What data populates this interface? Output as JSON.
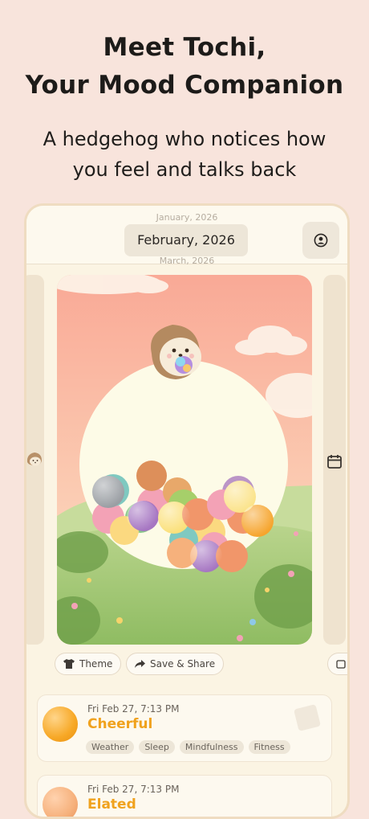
{
  "hero": {
    "title_line1": "Meet Tochi,",
    "title_line2": "Your Mood Companion",
    "subtitle_line1": "A hedgehog who notices how",
    "subtitle_line2": "you feel and talks back"
  },
  "header": {
    "prev_month": "January, 2026",
    "current_month": "February, 2026",
    "next_month": "March, 2026",
    "profile_icon": "profile-icon"
  },
  "side": {
    "left_icon": "hedgehog-icon",
    "right_icon": "calendar-icon"
  },
  "colors": {
    "background": "#f8e4dc",
    "accent": "#f0a21e",
    "card": "#fdf9ef"
  },
  "actions": {
    "theme_label": "Theme",
    "theme_icon": "shirt-icon",
    "share_label": "Save & Share",
    "share_icon": "share-arrow-icon"
  },
  "entries": [
    {
      "datetime": "Fri Feb 27, 7:13 PM",
      "mood": "Cheerful",
      "orb_color": "#f7a826",
      "tags": [
        "Weather",
        "Sleep",
        "Mindfulness",
        "Fitness"
      ]
    },
    {
      "datetime": "Fri Feb 27, 7:13 PM",
      "mood": "Elated",
      "orb_color": "#f6b17c",
      "tags": []
    }
  ]
}
